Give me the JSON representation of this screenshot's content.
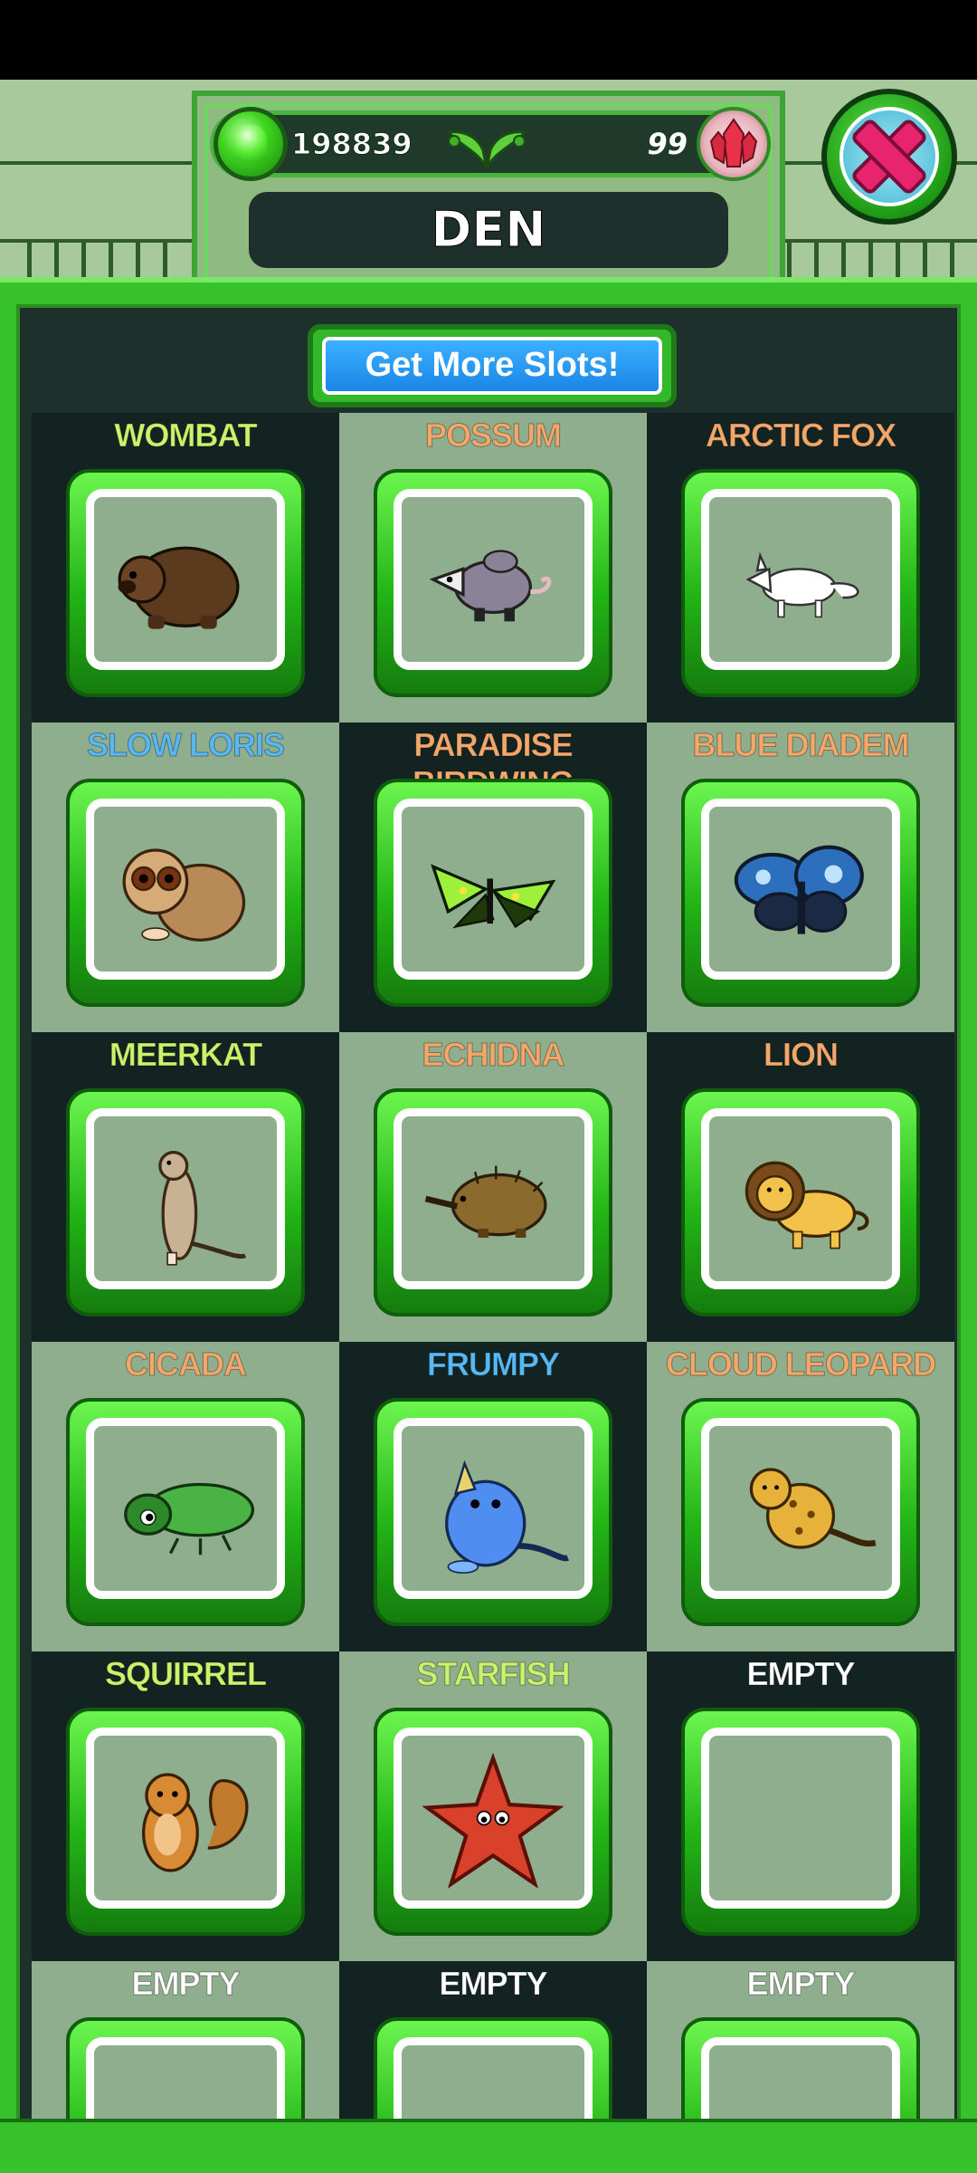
{
  "header": {
    "gem_count": "198839",
    "crystal_count": "99",
    "title": "DEN"
  },
  "actions": {
    "get_more_slots": "Get More Slots!"
  },
  "colors": {
    "name_green": "#c9f36a",
    "name_orange": "#f2a86a",
    "name_blue": "#59b7f2",
    "name_white": "#ffffff"
  },
  "den": {
    "slots": [
      {
        "name": "WOMBAT",
        "color": "#c9f36a",
        "icon": "wombat-icon"
      },
      {
        "name": "POSSUM",
        "color": "#f2a86a",
        "icon": "possum-icon"
      },
      {
        "name": "ARCTIC FOX",
        "color": "#f2a86a",
        "icon": "arctic-fox-icon"
      },
      {
        "name": "SLOW LORIS",
        "color": "#59b7f2",
        "icon": "slow-loris-icon"
      },
      {
        "name": "PARADISE BIRDWING",
        "color": "#f2a86a",
        "icon": "birdwing-butterfly-icon"
      },
      {
        "name": "BLUE DIADEM",
        "color": "#f2a86a",
        "icon": "blue-diadem-butterfly-icon"
      },
      {
        "name": "MEERKAT",
        "color": "#c9f36a",
        "icon": "meerkat-icon"
      },
      {
        "name": "ECHIDNA",
        "color": "#f2a86a",
        "icon": "echidna-icon"
      },
      {
        "name": "LION",
        "color": "#f2a86a",
        "icon": "lion-icon"
      },
      {
        "name": "CICADA",
        "color": "#f2a86a",
        "icon": "cicada-icon"
      },
      {
        "name": "FRUMPY",
        "color": "#59b7f2",
        "icon": "frumpy-icon"
      },
      {
        "name": "CLOUD LEOPARD",
        "color": "#f2a86a",
        "icon": "cloud-leopard-icon"
      },
      {
        "name": "SQUIRREL",
        "color": "#c9f36a",
        "icon": "squirrel-icon"
      },
      {
        "name": "STARFISH",
        "color": "#c9f36a",
        "icon": "starfish-icon"
      },
      {
        "name": "EMPTY",
        "color": "#ffffff",
        "icon": ""
      },
      {
        "name": "EMPTY",
        "color": "#ffffff",
        "icon": ""
      },
      {
        "name": "EMPTY",
        "color": "#ffffff",
        "icon": ""
      },
      {
        "name": "EMPTY",
        "color": "#ffffff",
        "icon": ""
      }
    ]
  }
}
